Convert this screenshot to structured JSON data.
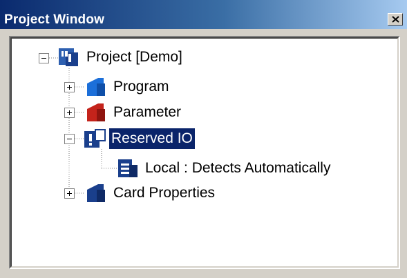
{
  "window": {
    "title": "Project Window",
    "close_label": "x"
  },
  "tree": {
    "root": {
      "label": "Project [Demo]",
      "icon": "project-icon",
      "expander": "minus"
    },
    "children": [
      {
        "label": "Program",
        "icon": "program-icon",
        "color": "#1c6fd9",
        "expander": "plus"
      },
      {
        "label": "Parameter",
        "icon": "parameter-icon",
        "color": "#c4231b",
        "expander": "plus"
      },
      {
        "label": "Reserved IO",
        "icon": "reserved-io-icon",
        "color": "#1a3f8c",
        "expander": "minus",
        "selected": true,
        "children": [
          {
            "label": "Local : Detects Automatically",
            "icon": "local-io-icon",
            "color": "#1a3f8c"
          }
        ]
      },
      {
        "label": "Card Properties",
        "icon": "card-properties-icon",
        "color": "#1a3f8c",
        "expander": "plus"
      }
    ]
  },
  "colors": {
    "title_bar_start": "#0a2a6e",
    "title_bar_end": "#a6caf0",
    "selection": "#0a246a",
    "face": "#d4d0c8"
  }
}
